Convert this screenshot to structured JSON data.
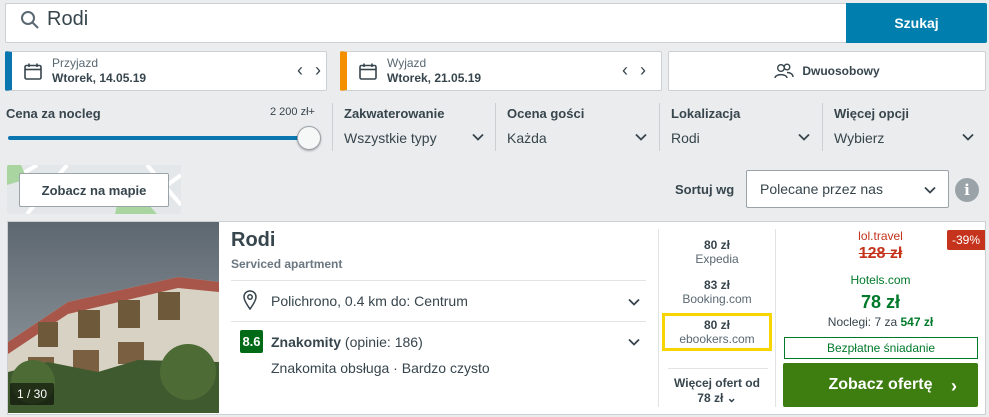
{
  "search": {
    "value": "Rodi",
    "button_label": "Szukaj"
  },
  "checkin": {
    "label": "Przyjazd",
    "date": "Wtorek, 14.05.19"
  },
  "checkout": {
    "label": "Wyjazd",
    "date": "Wtorek, 21.05.19"
  },
  "room": {
    "label": "Dwuosobowy"
  },
  "filters": {
    "price": {
      "label": "Cena za nocleg",
      "max": "2 200 zł+",
      "value": 1.0
    },
    "accommodation": {
      "label": "Zakwaterowanie",
      "value": "Wszystkie typy"
    },
    "rating": {
      "label": "Ocena gości",
      "value": "Każda"
    },
    "location": {
      "label": "Lokalizacja",
      "value": "Rodi"
    },
    "more": {
      "label": "Więcej opcji",
      "value": "Wybierz"
    }
  },
  "map": {
    "button_label": "Zobacz na mapie"
  },
  "sort": {
    "label": "Sortuj wg",
    "value": "Polecane przez nas"
  },
  "result": {
    "photo_count": "1 / 30",
    "name": "Rodi",
    "type": "Serviced apartment",
    "location": "Polichrono, 0.4 km do: Centrum",
    "rating_score": "8.6",
    "rating_word": "Znakomity",
    "rating_reviews": "(opinie: 186)",
    "rating_sub": "Znakomita obsługa · Bardzo czysto",
    "deals": [
      {
        "price": "80 zł",
        "site": "Expedia"
      },
      {
        "price": "83 zł",
        "site": "Booking.com"
      },
      {
        "price": "80 zł",
        "site": "ebookers.com"
      }
    ],
    "more_offers_label": "Więcej ofert od",
    "more_offers_price": "78 zł",
    "discount": "-39%",
    "old_site": "lol.travel",
    "old_price": "128 zł",
    "best_site": "Hotels.com",
    "best_price": "78 zł",
    "nights_prefix": "Noclegi: 7 za",
    "nights_total": "547 zł",
    "breakfast": "Bezpłatne śniadanie",
    "cta_label": "Zobacz ofertę"
  },
  "colors": {
    "primary_blue": "#007faf",
    "checkout_orange": "#f48f00",
    "green_cta": "#3e7d10",
    "discount_red": "#c5331c",
    "highlight_yellow": "#f7d500"
  }
}
